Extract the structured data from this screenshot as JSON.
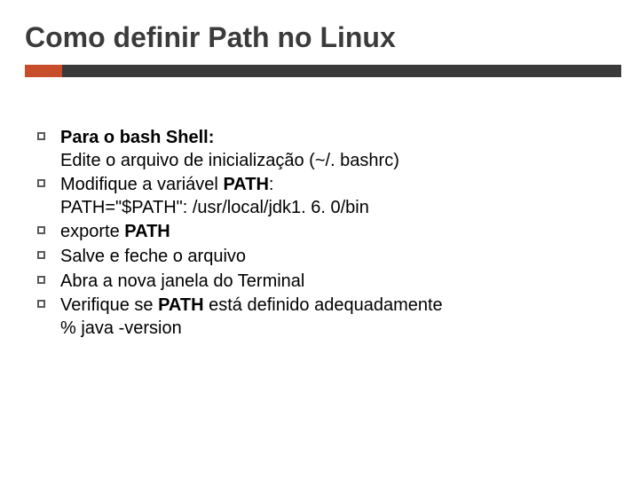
{
  "title": "Como definir Path no Linux",
  "bullets": [
    {
      "line1_bold": "Para o bash Shell:",
      "line2": "Edite o arquivo de inicialização (~/. bashrc)"
    },
    {
      "line1_prefix": "Modifique a variável ",
      "line1_bold_tail": "PATH",
      "line1_suffix": ":",
      "line2": "PATH=\"$PATH\": /usr/local/jdk1. 6. 0/bin"
    },
    {
      "line1_prefix": "exporte ",
      "line1_bold_tail": "PATH"
    },
    {
      "line1": "Salve e feche o arquivo"
    },
    {
      "line1": "Abra a nova janela do Terminal"
    },
    {
      "line1_prefix": "Verifique se ",
      "line1_bold_tail": "PATH",
      "line1_suffix": " está definido adequadamente",
      "line2": "% java -version"
    }
  ]
}
